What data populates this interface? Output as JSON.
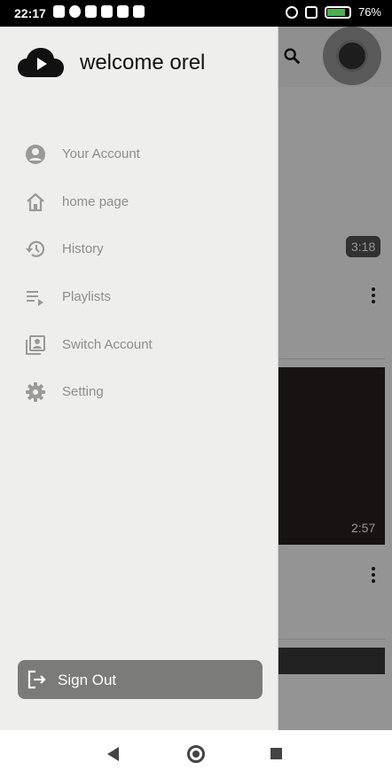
{
  "status_bar": {
    "time": "22:17",
    "battery_percent": "76%",
    "battery_level": 0.76
  },
  "background_app": {
    "durations": [
      "3:18",
      "2:57"
    ]
  },
  "drawer": {
    "welcome": "welcome orel",
    "menu": [
      {
        "label": "Your Account",
        "icon": "account-circle-icon"
      },
      {
        "label": "home page",
        "icon": "home-icon"
      },
      {
        "label": "History",
        "icon": "history-icon"
      },
      {
        "label": "Playlists",
        "icon": "playlist-icon"
      },
      {
        "label": "Switch Account",
        "icon": "switch-account-icon"
      },
      {
        "label": "Setting",
        "icon": "settings-icon"
      }
    ],
    "sign_out": "Sign Out"
  },
  "colors": {
    "drawer_bg": "#eeeeec",
    "menu_text": "#8d8d8d",
    "signout_bg": "#7b7b7a"
  }
}
